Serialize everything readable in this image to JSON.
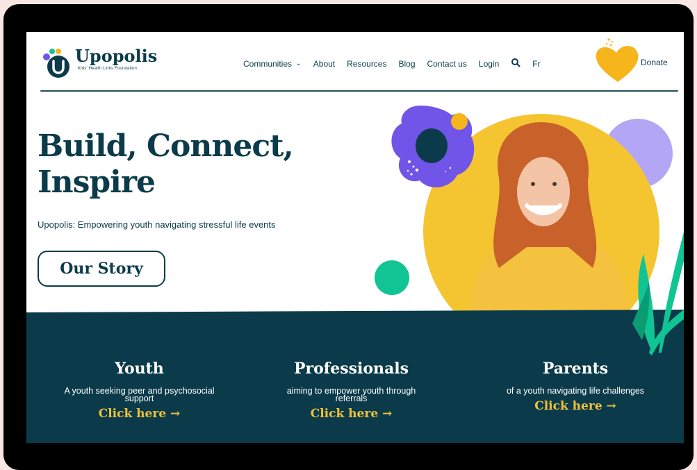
{
  "brand": {
    "name": "Upopolis",
    "tagline": "Kids' Health Links Foundation",
    "colors": {
      "navy": "#0b3b4a",
      "yellow": "#f5b51b",
      "purple": "#7155e8",
      "green": "#10c493",
      "lavender": "#b2a6f5"
    }
  },
  "nav": {
    "items": [
      "Communities",
      "About",
      "Resources",
      "Blog",
      "Contact us",
      "Login"
    ],
    "communities_caret": "⌄",
    "search_icon": "search-icon",
    "language": "Fr",
    "donate": "Donate"
  },
  "hero": {
    "title_line1": "Build, Connect,",
    "title_line2": "Inspire",
    "subtitle": "Upopolis: Empowering youth navigating stressful life events",
    "cta": "Our Story"
  },
  "audiences": [
    {
      "title": "Youth",
      "desc_line1": "A youth seeking peer and psychosocial",
      "desc_line2": "support",
      "link": "Click here →"
    },
    {
      "title": "Professionals",
      "desc_line1": "aiming to empower youth through",
      "desc_line2": "referrals",
      "link": "Click here →"
    },
    {
      "title": "Parents",
      "desc_line1": "of a youth navigating life challenges",
      "desc_line2": "",
      "link": "Click here →"
    }
  ]
}
